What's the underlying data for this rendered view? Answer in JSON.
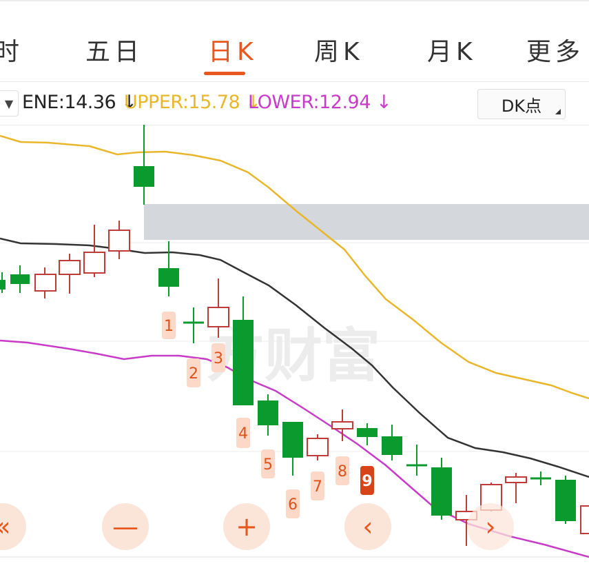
{
  "tabs": [
    {
      "label": "时",
      "active": false
    },
    {
      "label": "五日",
      "active": false
    },
    {
      "label": "日K",
      "active": true
    },
    {
      "label": "周K",
      "active": false
    },
    {
      "label": "月K",
      "active": false
    },
    {
      "label": "更多",
      "active": false
    }
  ],
  "indicator": {
    "ene": "ENE:14.36 ↓",
    "upper": "UPPER:15.78 ↓",
    "lower": "LOWER:12.94 ↓",
    "dk_button": "DK点"
  },
  "colors": {
    "accent": "#e8571e",
    "up": "#c03a3a",
    "down": "#0a9a2e",
    "upper": "#e9b62a",
    "lower": "#c83bc8",
    "ene": "#333333"
  },
  "watermark": "方财富",
  "signals": [
    "1",
    "2",
    "3",
    "4",
    "5",
    "6",
    "7",
    "8",
    "9"
  ],
  "controls": {
    "scroll_left": "«",
    "zoom_out": "—",
    "zoom_in": "+",
    "prev": "‹",
    "next": "›"
  }
}
